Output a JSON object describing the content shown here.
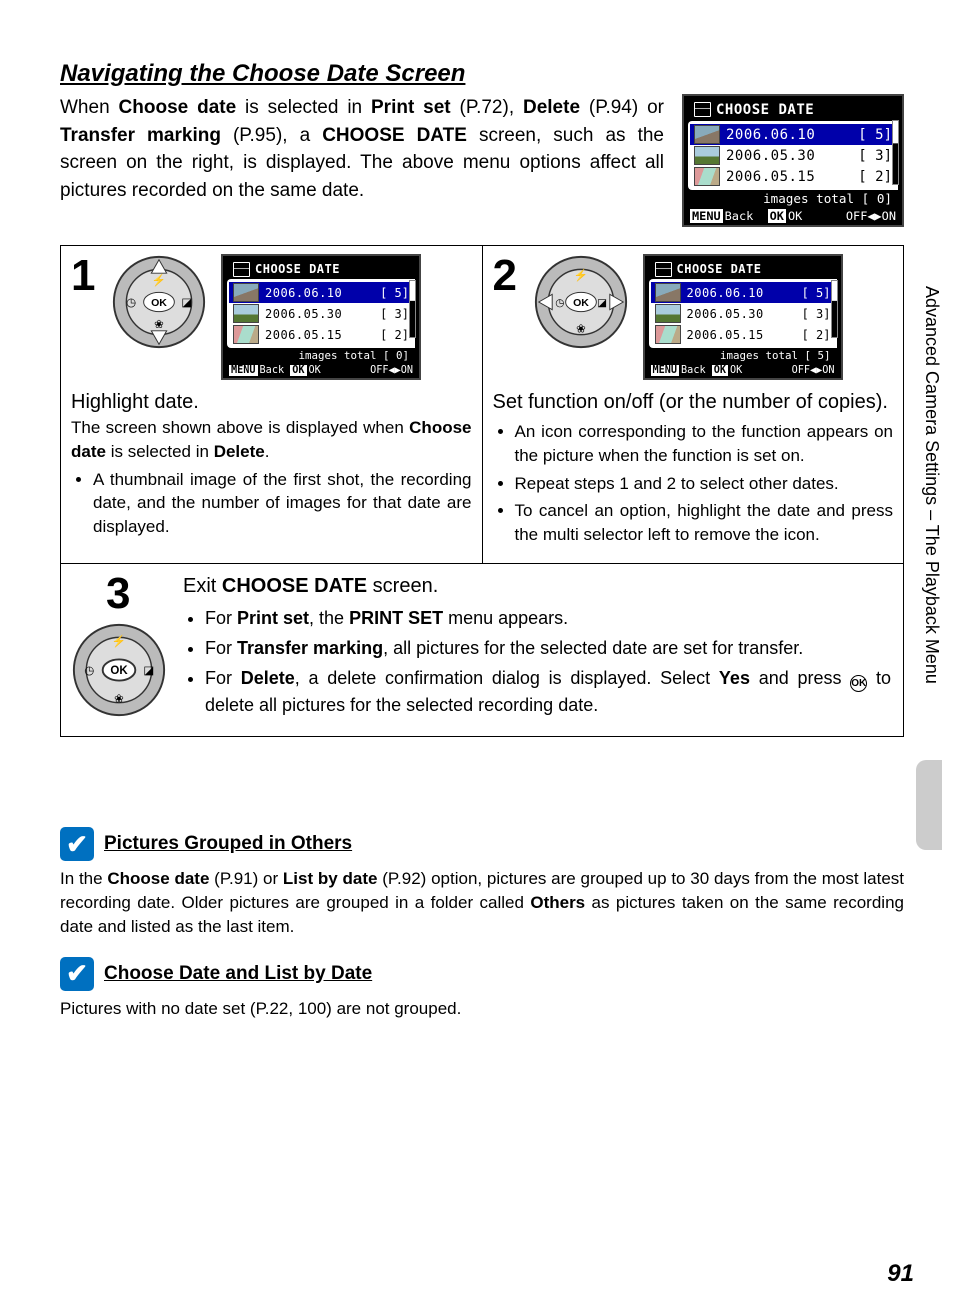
{
  "page": {
    "title": "Navigating the Choose Date Screen",
    "side_tab": "Advanced Camera Settings – The Playback Menu",
    "number": "91"
  },
  "intro": {
    "text_pre": "When ",
    "b1": "Choose date",
    "text_1": " is selected in ",
    "b2": "Print set",
    "text_2": " (P.72), ",
    "b3": "Delete",
    "text_3": " (P.94) or ",
    "b4": "Transfer marking",
    "text_4": " (P.95), a ",
    "b5": "CHOOSE DATE",
    "text_5": " screen, such as the screen on the right, is displayed. The above menu options affect all pictures recorded on the same date."
  },
  "lcd": {
    "title": "CHOOSE DATE",
    "rows": [
      {
        "date": "2006.06.10",
        "count": "[   5]"
      },
      {
        "date": "2006.05.30",
        "count": "[   3]"
      },
      {
        "date": "2006.05.15",
        "count": "[   2]"
      }
    ],
    "total_label": "images total",
    "total_0": "[   0]",
    "total_5": "[   5]",
    "foot_back_tag": "MENU",
    "foot_back": "Back",
    "foot_ok_tag": "OK",
    "foot_ok": "OK",
    "foot_right": "OFF◀▶ON"
  },
  "step1": {
    "num": "1",
    "lead": "Highlight date.",
    "line1a": "The screen shown above is displayed when ",
    "line1b": "Choose date",
    "line1c": " is selected in ",
    "line1d": "Delete",
    "line1e": ".",
    "bullet1": "A thumbnail image of the first shot, the recording date, and the number of images for that date are displayed."
  },
  "step2": {
    "num": "2",
    "lead": "Set function on/off (or the number of copies).",
    "bullet1": "An icon corresponding to the function appears on the picture when the function is set on.",
    "bullet2": "Repeat steps 1 and 2 to select other dates.",
    "bullet3": "To cancel an option, highlight the date and press the multi selector left to remove the icon."
  },
  "step3": {
    "num": "3",
    "lead_a": "Exit ",
    "lead_b": "CHOOSE DATE",
    "lead_c": " screen.",
    "b1_a": "For ",
    "b1_b": "Print set",
    "b1_c": ", the ",
    "b1_d": "PRINT SET",
    "b1_e": " menu appears.",
    "b2_a": "For ",
    "b2_b": "Transfer marking",
    "b2_c": ", all pictures for the selected date are set for transfer.",
    "b3_a": "For ",
    "b3_b": "Delete",
    "b3_c": ", a delete confirmation dialog is displayed. Select ",
    "b3_d": "Yes",
    "b3_e": " and press ",
    "b3_f": " to delete all pictures for the selected recording date."
  },
  "note1": {
    "title": "Pictures Grouped in Others",
    "text_a": "In the ",
    "text_b": "Choose date",
    "text_c": " (P.91) or ",
    "text_d": "List by date",
    "text_e": " (P.92) option, pictures are grouped up to 30 days from the most latest recording date. Older pictures are grouped in a folder called ",
    "text_f": "Others",
    "text_g": " as pictures taken on the same recording date and listed as the last item."
  },
  "note2": {
    "title": "Choose Date and List by Date",
    "text": "Pictures with no date set (P.22, 100) are not grouped."
  }
}
